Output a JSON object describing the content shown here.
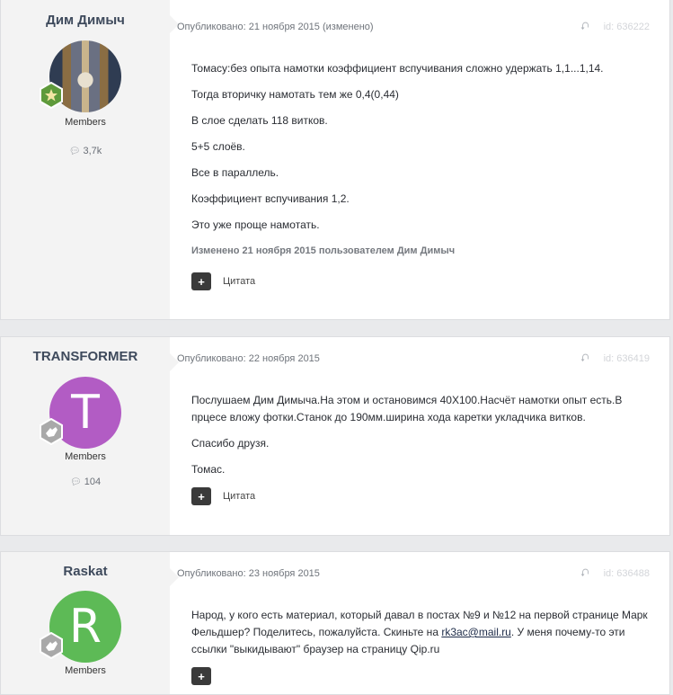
{
  "posts": [
    {
      "author": "Дим Димыч",
      "avatar_letter": "",
      "avatar_color": "#6a7082",
      "group": "Members",
      "posts_count": "3,7k",
      "published": "Опубликовано: 21 ноября 2015 (изменено)",
      "post_id": "id: 636222",
      "paragraphs": [
        "Томасу:без опыта намотки коэффициент вспучивания сложно удержать 1,1...1,14.",
        "Тогда вторичку намотать тем же 0,4(0,44)",
        "В слое сделать 118 витков.",
        "5+5 слоёв.",
        "Все в параллель.",
        "Коэффициент вспучивания 1,2.",
        "Это уже проще намотать."
      ],
      "edited": "Изменено 21 ноября 2015 пользователем Дим Димыч",
      "quote_label": "Цитата"
    },
    {
      "author": "TRANSFORMER",
      "avatar_letter": "T",
      "avatar_color": "#b25cc4",
      "group": "Members",
      "posts_count": "104",
      "published": "Опубликовано: 22 ноября 2015",
      "post_id": "id: 636419",
      "paragraphs": [
        "Послушаем Дим Димыча.На этом и остановимся 40Х100.Насчёт намотки опыт есть.В прцесе вложу фотки.Станок до 190мм.ширина хода каретки укладчика витков.",
        "Спасибо друзя.",
        "Томас."
      ],
      "quote_label": "Цитата"
    },
    {
      "author": "Raskat",
      "avatar_letter": "R",
      "avatar_color": "#5dba56",
      "group": "Members",
      "published": "Опубликовано: 23 ноября 2015",
      "post_id": "id: 636488",
      "p1_before": "Народ, у кого есть материал, который давал в постах №9 и №12 на первой странице Марк Фельдшер? Поделитесь, пожалуйста. Скиньте на ",
      "p1_link": "rk3ac@mail.ru",
      "p1_after": ". У меня почему-то эти ссылки \"выкидывают\" браузер на страницу Qip.ru"
    }
  ],
  "icons": {
    "share": "share-icon",
    "comment": "comment-bubble-icon",
    "quote": "plus-icon",
    "rank_star": "star-badge-icon",
    "rank_hand": "hand-badge-icon"
  }
}
